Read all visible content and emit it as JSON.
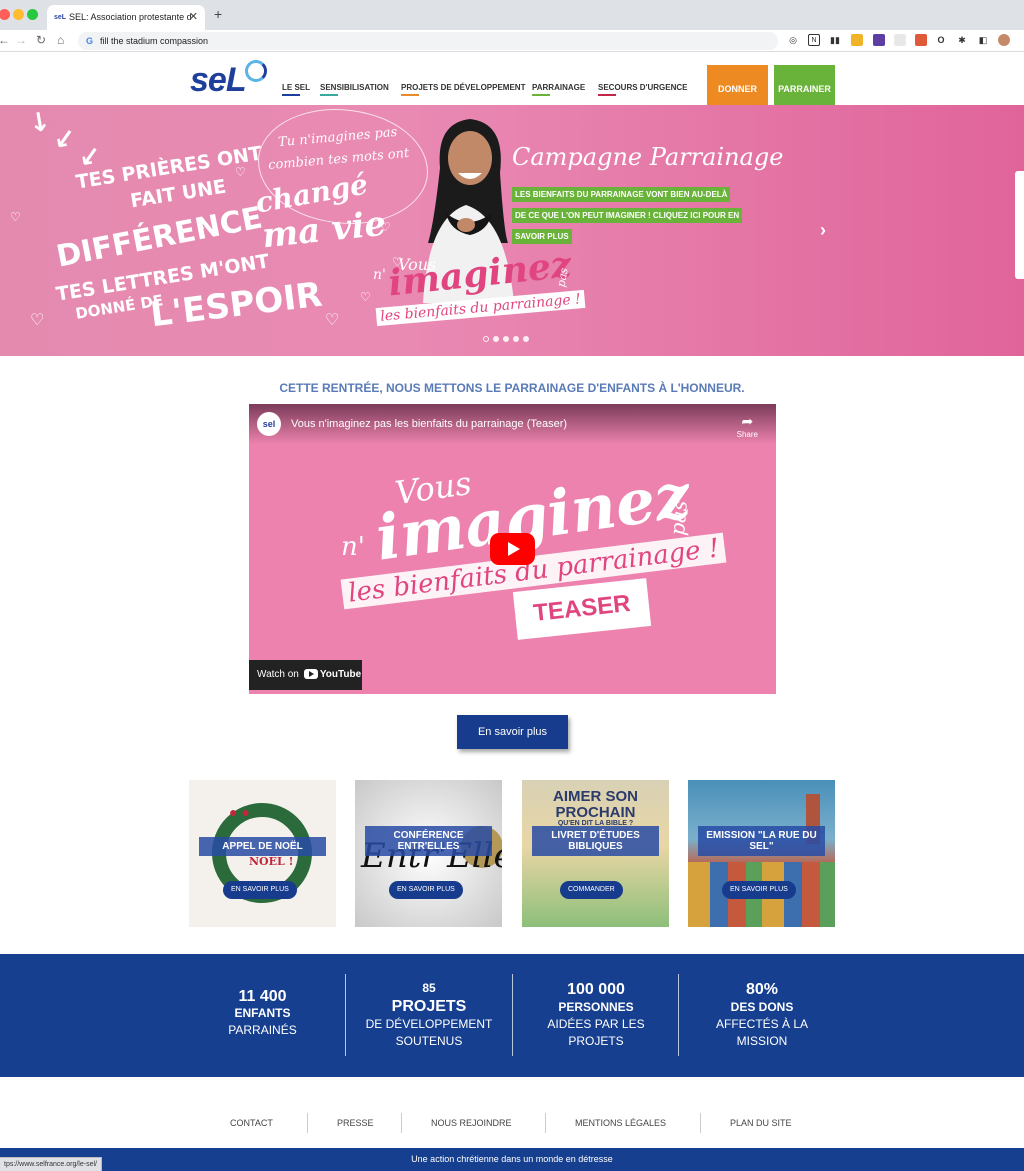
{
  "browser": {
    "tab_title": "SEL: Association protestante d",
    "address": "fill the stadium compassion",
    "status_url": "tps://www.selfrance.org/le-sel/"
  },
  "header": {
    "logo": "seL",
    "nav": [
      {
        "label": "LE SEL",
        "color": "#1e3f9b"
      },
      {
        "label": "SENSIBILISATION",
        "color": "#39a9a0"
      },
      {
        "label": "PROJETS DE DÉVELOPPEMENT",
        "color": "#e98b2a"
      },
      {
        "label": "PARRAINAGE",
        "color": "#6ab33a"
      },
      {
        "label": "SECOURS D'URGENCE",
        "color": "#c0274a"
      }
    ],
    "donate_label": "DONNER",
    "sponsor_label": "PARRAINER"
  },
  "hero": {
    "prayers_line1": "TES PRIÈRES ONT",
    "prayers_line2": "FAIT UNE",
    "prayers_line3": "DIFFÉRENCE",
    "letters_line1": "TES LETTRES M'ONT",
    "letters_line2": "DONNÉ DE",
    "letters_line3": "L'ESPOIR",
    "bubble_line1": "Tu n'imagines pas",
    "bubble_line2": "combien tes mots ont",
    "bubble_line3": "changé",
    "bubble_line4": "ma vie",
    "brand_vous": "Vous",
    "brand_n": "n'",
    "brand_imaginez": "imaginez",
    "brand_pas": "pas",
    "brand_bienfaits": "les bienfaits du parrainage !",
    "campaign_title": "Campagne Parrainage",
    "campaign_line1": "LES BIENFAITS DU PARRAINAGE VONT BIEN AU-DELÀ",
    "campaign_line2": "DE CE QUE L'ON PEUT IMAGINER ! CLIQUEZ ICI POUR EN",
    "campaign_line3": "SAVOIR PLUS",
    "prev_arrow": "‹",
    "next_arrow": "›",
    "slide_count": 5,
    "active_slide": 1
  },
  "intro": {
    "heading": "CETTE RENTRÉE, NOUS METTONS LE PARRAINAGE D'ENFANTS À L'HONNEUR."
  },
  "video": {
    "channel_icon": "sel",
    "title": "Vous n'imaginez pas les bienfaits du parrainage (Teaser)",
    "share_label": "Share",
    "teaser_label": "TEASER",
    "watch_on": "Watch on",
    "youtube": "YouTube",
    "thumb_vous": "Vous",
    "thumb_n": "n'",
    "thumb_imaginez": "imaginez",
    "thumb_pas": "pas",
    "thumb_bienfaits": "les bienfaits du parrainage !"
  },
  "learn_more_label": "En savoir plus",
  "cards": [
    {
      "title": "APPEL DE NOËL",
      "button": "EN SAVOIR PLUS",
      "art": "NOËL !"
    },
    {
      "title": "CONFÉRENCE ENTR'ELLES",
      "button": "EN SAVOIR PLUS",
      "art": "Entr'Elles"
    },
    {
      "title": "LIVRET D'ÉTUDES BIBLIQUES",
      "button": "COMMANDER",
      "art_line1": "AIMER SON",
      "art_line2": "PROCHAIN",
      "art_line3": "QU'EN DIT LA BIBLE ?"
    },
    {
      "title": "EMISSION \"LA RUE DU SEL\"",
      "button": "EN SAVOIR PLUS"
    }
  ],
  "stats": [
    {
      "number": "11 400",
      "line1": "ENFANTS",
      "line2": "PARRAINÉS"
    },
    {
      "number": "85",
      "line1": "PROJETS",
      "line2": "DE DÉVELOPPEMENT",
      "line3": "SOUTENUS"
    },
    {
      "number": "100 000",
      "line1": "PERSONNES",
      "line2": "AIDÉES PAR LES",
      "line3": "PROJETS"
    },
    {
      "number": "80%",
      "line1": "DES DONS",
      "line2": "AFFECTÉS À LA",
      "line3": "MISSION"
    }
  ],
  "footer": {
    "links": [
      "CONTACT",
      "PRESSE",
      "NOUS REJOINDRE",
      "MENTIONS LÉGALES",
      "PLAN DU SITE"
    ],
    "tagline": "Une action chrétienne dans un monde en détresse"
  }
}
